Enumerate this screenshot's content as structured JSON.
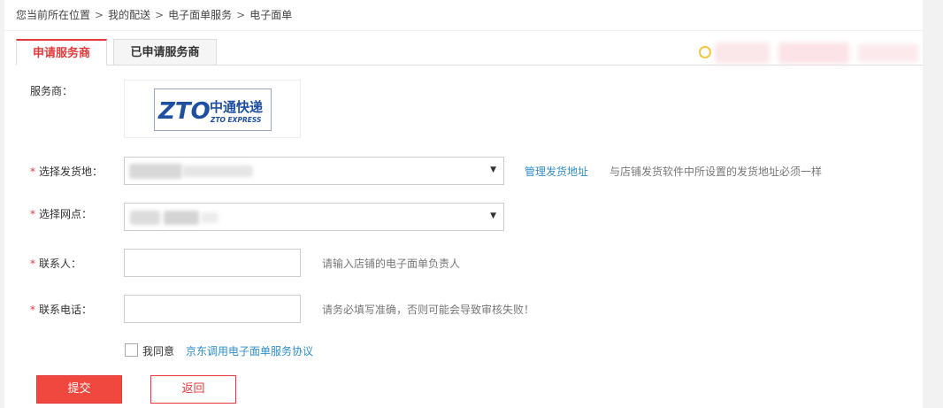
{
  "breadcrumb": {
    "items": [
      "您当前所在位置",
      "我的配送",
      "电子面单服务",
      "电子面单"
    ],
    "separator": ">"
  },
  "tabs": [
    {
      "label": "申请服务商",
      "active": true
    },
    {
      "label": "已申请服务商",
      "active": false
    }
  ],
  "form": {
    "provider": {
      "label": "服务商：",
      "logo": {
        "name": "zto-express-logo",
        "brand_text": "中通快递",
        "brand_sub": "ZTO EXPRESS",
        "mark": "ZTO"
      }
    },
    "ship_from": {
      "required_mark": "*",
      "label": "选择发货地：",
      "manage_link": "管理发货地址",
      "hint": "与店铺发货软件中所设置的发货地址必须一样"
    },
    "outlet": {
      "required_mark": "*",
      "label": "选择网点："
    },
    "contact": {
      "required_mark": "*",
      "label": "联系人：",
      "value": "",
      "hint": "请输入店铺的电子面单负责人"
    },
    "phone": {
      "required_mark": "*",
      "label": "联系电话：",
      "value": "",
      "hint": "请务必填写准确，否则可能会导致审核失败！"
    },
    "agreement": {
      "checked": false,
      "label": "我同意",
      "link": "京东调用电子面单服务协议"
    }
  },
  "buttons": {
    "submit": "提交",
    "back": "返回"
  },
  "colors": {
    "accent_red": "#e4393c",
    "link_blue": "#2f8ec9",
    "zto_blue": "#1e4fa0"
  }
}
